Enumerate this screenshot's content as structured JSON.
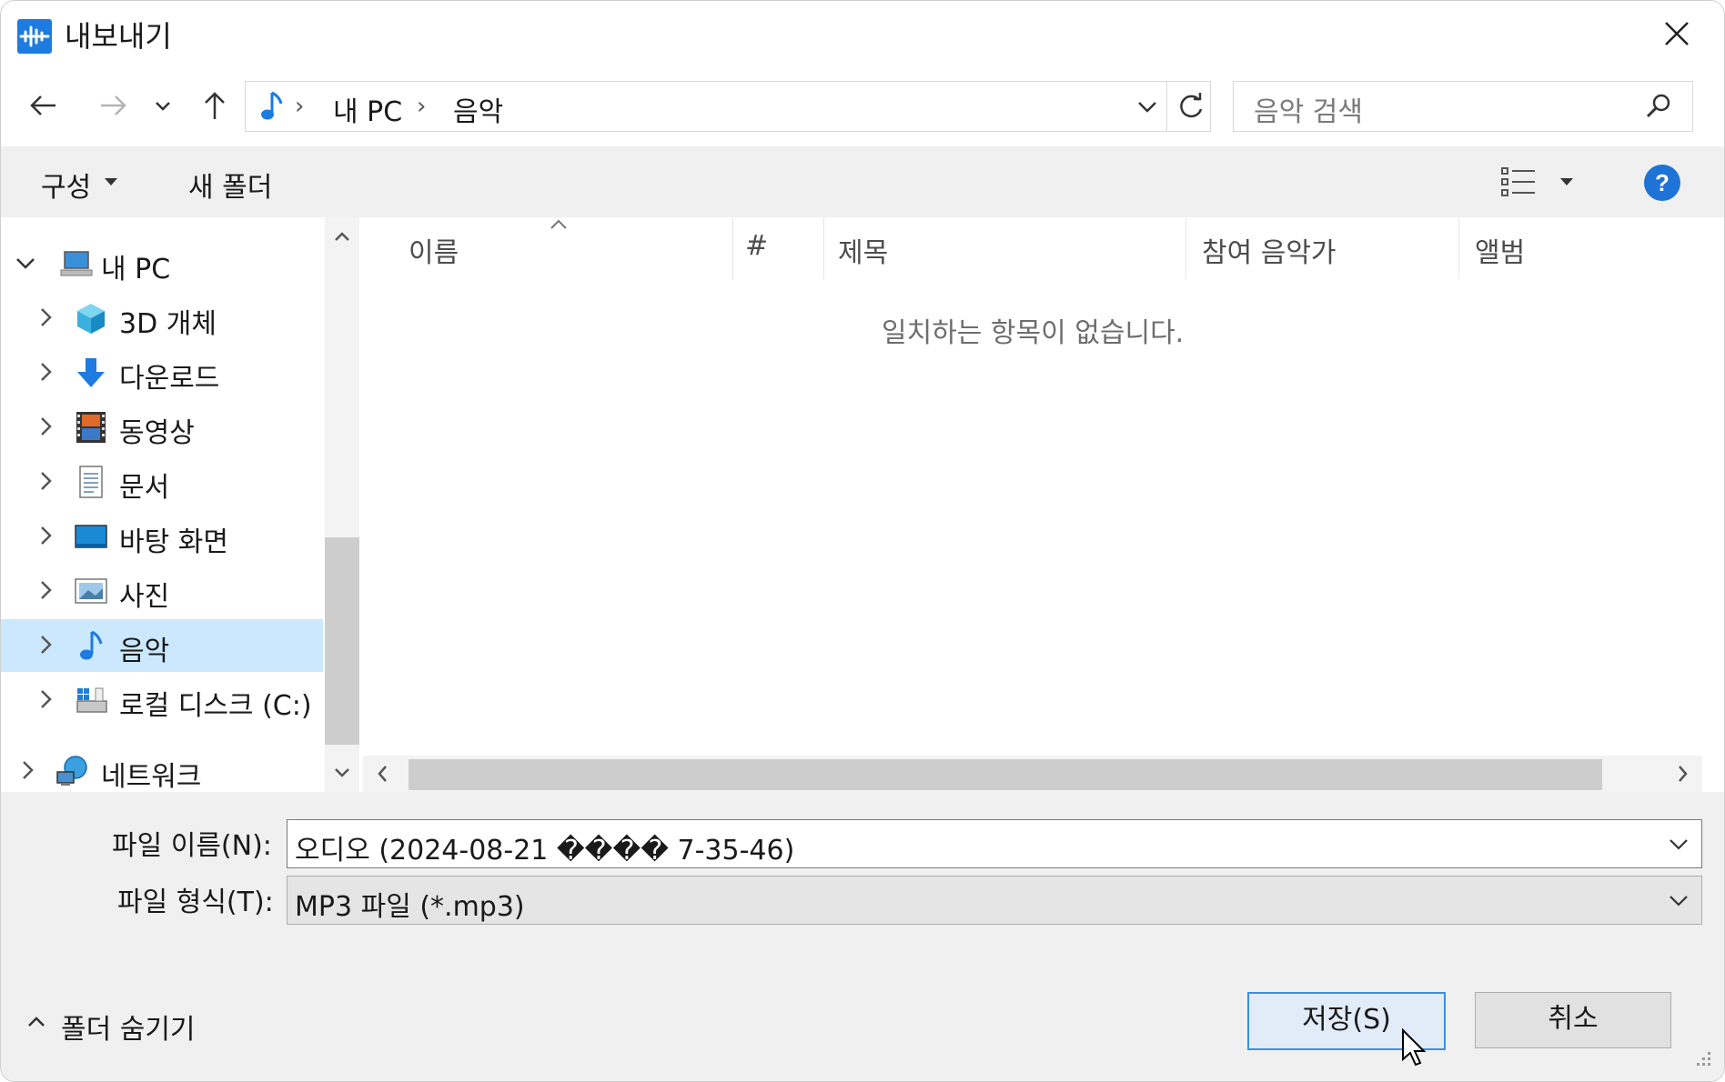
{
  "window": {
    "title": "내보내기"
  },
  "address": {
    "crumbs": [
      "내 PC",
      "음악"
    ]
  },
  "search": {
    "placeholder": "음악 검색"
  },
  "toolbar": {
    "organize": "구성",
    "new_folder": "새 폴더"
  },
  "tree": {
    "root": "내 PC",
    "items": [
      "3D 개체",
      "다운로드",
      "동영상",
      "문서",
      "바탕 화면",
      "사진",
      "음악",
      "로컬 디스크 (C:)"
    ],
    "selected": "음악",
    "network": "네트워크"
  },
  "columns": [
    "이름",
    "#",
    "제목",
    "참여 음악가",
    "앨범"
  ],
  "empty_message": "일치하는 항목이 없습니다.",
  "form": {
    "filename_label": "파일 이름(N):",
    "filename_value": "오디오 (2024-08-21 ���� 7-35-46)",
    "filetype_label": "파일 형식(T):",
    "filetype_value": "MP3 파일 (*.mp3)"
  },
  "footer": {
    "hide_folders": "폴더 숨기기"
  },
  "buttons": {
    "save": "저장(S)",
    "cancel": "취소"
  },
  "colors": {
    "accent": "#1e7be0",
    "selected_row": "#cce8ff",
    "save_border": "#3c8ee0"
  }
}
